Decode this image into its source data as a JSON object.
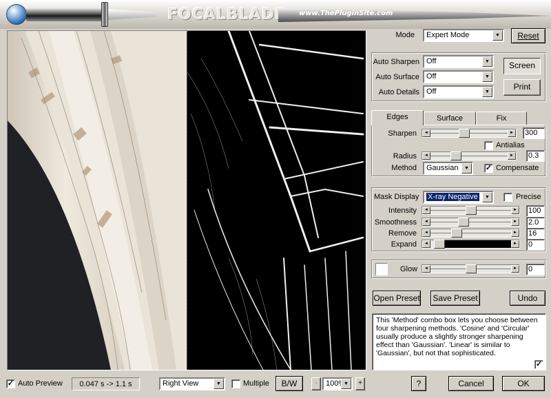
{
  "header": {
    "logo": "FOCALBLADE",
    "site": "www.ThePluginSite.com"
  },
  "mode": {
    "label": "Mode",
    "value": "Expert Mode",
    "reset_label": "Reset"
  },
  "auto": {
    "sharpen": {
      "label": "Auto Sharpen",
      "value": "Off"
    },
    "surface": {
      "label": "Auto Surface",
      "value": "Off"
    },
    "details": {
      "label": "Auto Details",
      "value": "Off"
    },
    "screen_label": "Screen",
    "print_label": "Print"
  },
  "tabs": [
    {
      "label": "Edges",
      "active": true
    },
    {
      "label": "Surface",
      "active": false
    },
    {
      "label": "Fix",
      "active": false
    }
  ],
  "edges": {
    "sharpen": {
      "label": "Sharpen",
      "value": "300",
      "level": 0.43
    },
    "antialias": {
      "label": "Antialias",
      "checked": false
    },
    "radius": {
      "label": "Radius",
      "value": "0.3",
      "level": 0.3
    },
    "method": {
      "label": "Method",
      "value": "Gaussian"
    },
    "compensate": {
      "label": "Compensate",
      "checked": true
    }
  },
  "mask": {
    "display": {
      "label": "Mask Display",
      "value": "X-ray Negative"
    },
    "precise": {
      "label": "Precise",
      "checked": false
    },
    "intensity": {
      "label": "Intensity",
      "value": "100",
      "level": 0.5
    },
    "smoothness": {
      "label": "Smoothness",
      "value": "2.0",
      "level": 0.4
    },
    "remove": {
      "label": "Remove",
      "value": "16",
      "level": 0.3
    },
    "expand": {
      "label": "Expand",
      "value": "0",
      "level": 0.05
    }
  },
  "glow": {
    "label": "Glow",
    "value": "0",
    "level": 0.5,
    "checked": false
  },
  "presets": {
    "open_label": "Open Preset",
    "save_label": "Save Preset",
    "undo_label": "Undo"
  },
  "help": {
    "text": "This 'Method' combo box lets you choose between four sharpening methods. 'Cosine' and 'Circular' usually produce a slightly stronger sharpening effect than 'Gaussian'. 'Linear' is similar to 'Gaussian', but not that sophisticated.",
    "checked": true
  },
  "footer": {
    "auto_preview": {
      "label": "Auto Preview",
      "checked": true
    },
    "timing": "0.047 s -> 1.1 s",
    "view": "Right View",
    "multiple": {
      "label": "Multiple",
      "checked": false
    },
    "bw_label": "B/W",
    "minus": "-",
    "zoom": "100%",
    "plus": "+",
    "help_btn": "?",
    "cancel_label": "Cancel",
    "ok_label": "OK"
  }
}
